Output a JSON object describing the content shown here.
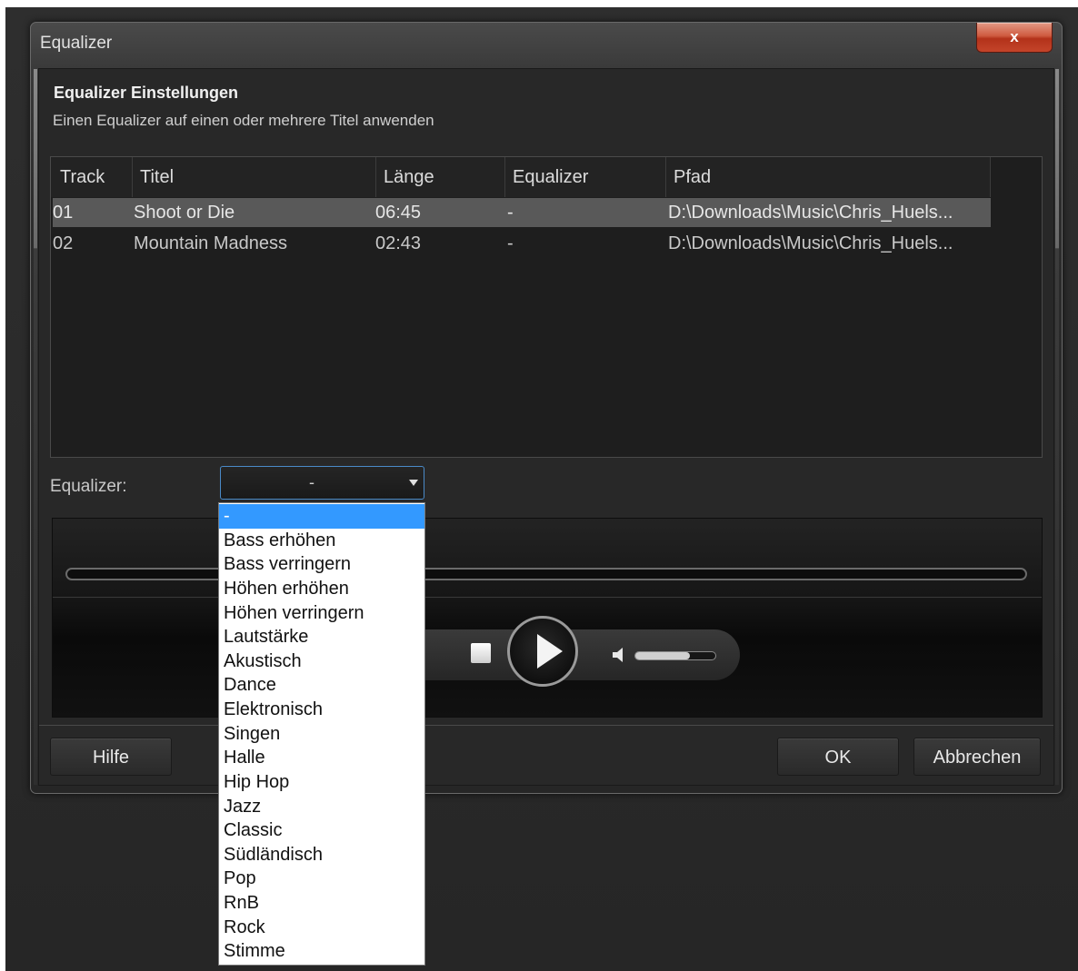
{
  "window": {
    "title": "Equalizer",
    "close_label": "x"
  },
  "header": {
    "title": "Equalizer Einstellungen",
    "subtitle": "Einen Equalizer auf einen oder mehrere Titel anwenden"
  },
  "table": {
    "columns": [
      "Track",
      "Titel",
      "Länge",
      "Equalizer",
      "Pfad"
    ],
    "rows": [
      {
        "track": "01",
        "title": "Shoot or Die",
        "length": "06:45",
        "equalizer": "-",
        "path": "D:\\Downloads\\Music\\Chris_Huels...",
        "selected": true
      },
      {
        "track": "02",
        "title": "Mountain Madness",
        "length": "02:43",
        "equalizer": "-",
        "path": "D:\\Downloads\\Music\\Chris_Huels...",
        "selected": false
      }
    ]
  },
  "equalizer_select": {
    "label": "Equalizer:",
    "value": "-",
    "options": [
      "-",
      "Bass erhöhen",
      "Bass verringern",
      "Höhen erhöhen",
      "Höhen verringern",
      "Lautstärke",
      "Akustisch",
      "Dance",
      "Elektronisch",
      "Singen",
      "Halle",
      "Hip Hop",
      "Jazz",
      "Classic",
      "Südländisch",
      "Pop",
      "RnB",
      "Rock",
      "Stimme"
    ],
    "selected_index": 0
  },
  "player": {
    "progress": 0,
    "volume": 0.68
  },
  "buttons": {
    "help": "Hilfe",
    "ok": "OK",
    "cancel": "Abbrechen"
  },
  "colors": {
    "selection": "#3399ff",
    "close_button": "#c4442a"
  }
}
